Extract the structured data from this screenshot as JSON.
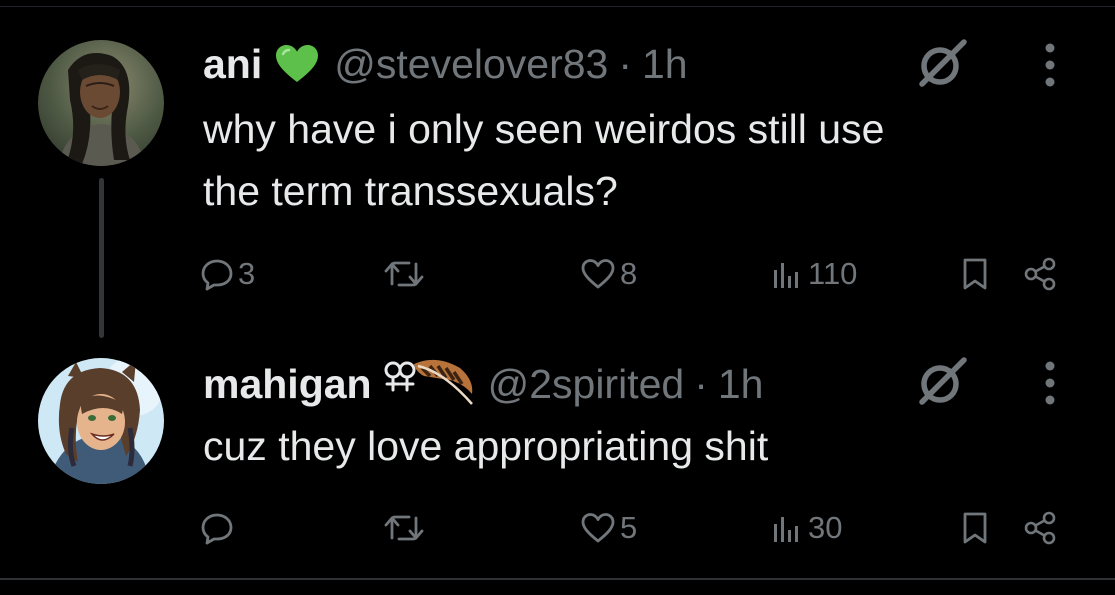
{
  "tweets": [
    {
      "display_name": "ani",
      "badge_icon": "green-heart-icon",
      "handle": "@stevelover83",
      "separator": "·",
      "time": "1h",
      "text_lines": [
        "why have i only seen weirdos still use",
        "the term transsexuals?"
      ],
      "stats": {
        "replies": "3",
        "likes": "8",
        "views": "110"
      }
    },
    {
      "display_name": "mahigan",
      "badge_icon": "symbol-and-feather-icon",
      "handle": "@2spirited",
      "separator": "·",
      "time": "1h",
      "text_lines": [
        "cuz they love appropriating shit"
      ],
      "stats": {
        "replies": "",
        "likes": "5",
        "views": "30"
      }
    }
  ],
  "colors": {
    "background": "#000000",
    "text_primary": "#e7e9ea",
    "text_secondary": "#71767b",
    "divider": "#2f3336",
    "heart_badge": "#5dc04a"
  }
}
